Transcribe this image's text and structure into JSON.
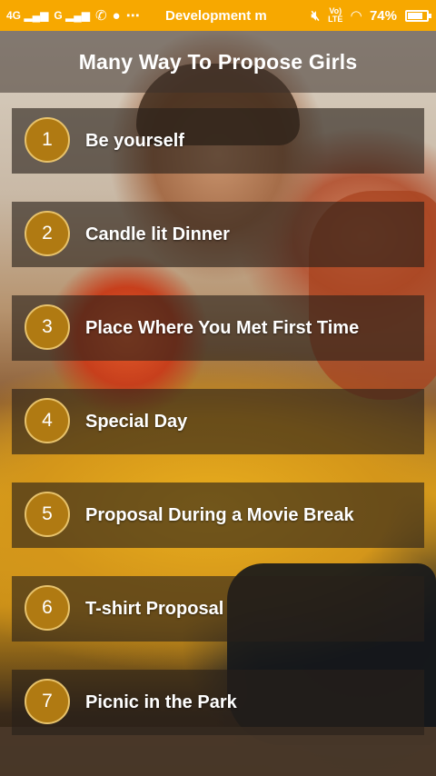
{
  "status_bar": {
    "net1": "4G",
    "net2": "G",
    "app_title": "Development m",
    "volte_top": "Vo)",
    "volte_bottom": "LTE",
    "battery_text": "74%",
    "battery_level": 0.74,
    "icons": [
      "signal-icon",
      "signal-icon",
      "whatsapp-icon",
      "chat-icon",
      "more-dots-icon",
      "mute-icon",
      "volte-icon",
      "wifi-icon",
      "battery-icon"
    ]
  },
  "header": {
    "title": "Many Way To Propose Girls"
  },
  "items": [
    {
      "number": "1",
      "label": "Be yourself"
    },
    {
      "number": "2",
      "label": "Candle lit Dinner"
    },
    {
      "number": "3",
      "label": "Place Where You Met First Time"
    },
    {
      "number": "4",
      "label": "Special Day"
    },
    {
      "number": "5",
      "label": "Proposal During a Movie Break"
    },
    {
      "number": "6",
      "label": "T-shirt Proposal"
    },
    {
      "number": "7",
      "label": "Picnic in the Park"
    }
  ],
  "colors": {
    "status_bar": "#f7a800",
    "number_circle": "#b07a12",
    "number_border": "#e7c26b"
  }
}
